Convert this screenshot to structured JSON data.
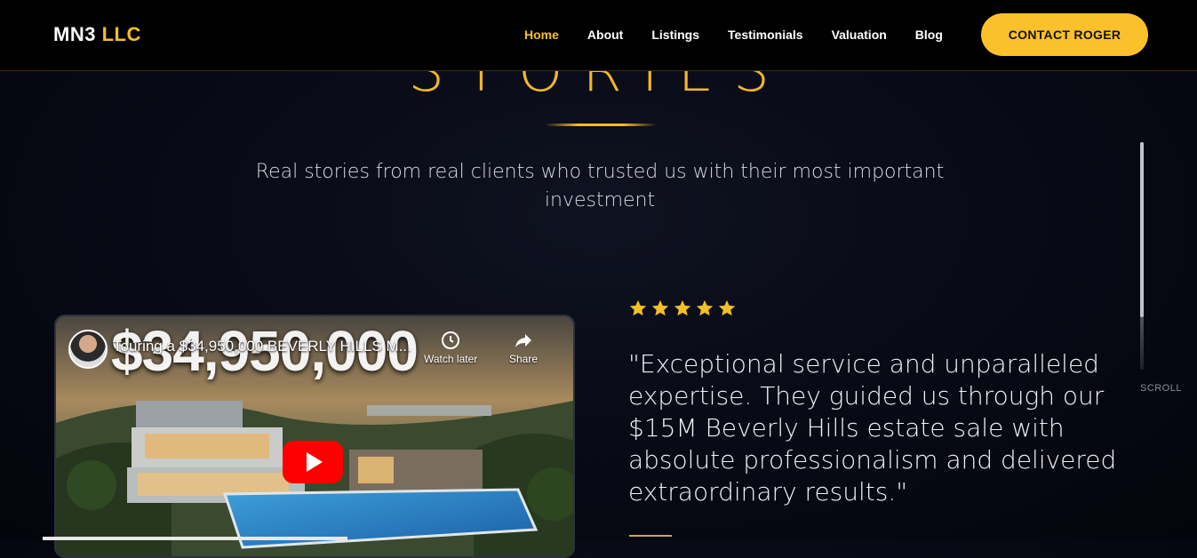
{
  "nav": {
    "logo_main": "MN3",
    "logo_accent": "LLC",
    "items": [
      {
        "label": "Home",
        "active": true
      },
      {
        "label": "About",
        "active": false
      },
      {
        "label": "Listings",
        "active": false
      },
      {
        "label": "Testimonials",
        "active": false
      },
      {
        "label": "Valuation",
        "active": false
      },
      {
        "label": "Blog",
        "active": false
      }
    ],
    "cta": "CONTACT ROGER"
  },
  "section": {
    "heading": "STORIES",
    "subtitle": "Real stories from real clients who trusted us with their most important investment"
  },
  "video": {
    "title": "Touring a $34,950,000 BEVERLY HILLS M...",
    "thumbnail_text": "$34,950,000",
    "watch_later": "Watch later",
    "share": "Share",
    "play_icon": "youtube-play-icon"
  },
  "testimonial": {
    "rating": 5,
    "quote": "\"Exceptional service and unparalleled expertise. They guided us through our $15M Beverly Hills estate sale with absolute professionalism and delivered extraordinary results.\""
  },
  "scroll": {
    "label": "SCROLL",
    "progress": 0.77
  },
  "colors": {
    "accent": "#f5c026",
    "cta_bg": "#fbc12a",
    "background": "#070914",
    "youtube_red": "#ff0000"
  }
}
